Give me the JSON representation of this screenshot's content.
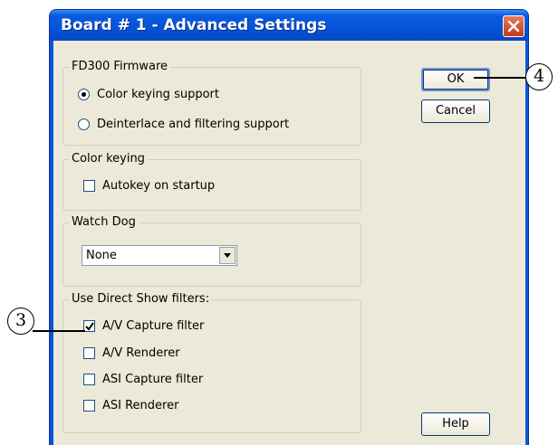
{
  "dialog": {
    "title": "Board # 1 - Advanced Settings"
  },
  "firmware": {
    "legend": "FD300 Firmware",
    "options": [
      {
        "label": "Color keying support",
        "selected": true
      },
      {
        "label": "Deinterlace and filtering support",
        "selected": false
      }
    ]
  },
  "color_keying": {
    "legend": "Color keying",
    "autokey_label": "Autokey on startup",
    "autokey_checked": false
  },
  "watch_dog": {
    "legend": "Watch Dog",
    "selected": "None"
  },
  "direct_show": {
    "legend": "Use Direct Show filters:",
    "items": [
      {
        "label": "A/V Capture filter",
        "checked": true
      },
      {
        "label": "A/V Renderer",
        "checked": false
      },
      {
        "label": "ASI Capture filter",
        "checked": false
      },
      {
        "label": "ASI Renderer",
        "checked": false
      }
    ]
  },
  "buttons": {
    "ok": "OK",
    "cancel": "Cancel",
    "help": "Help"
  },
  "callouts": {
    "left": "3",
    "right": "4"
  }
}
